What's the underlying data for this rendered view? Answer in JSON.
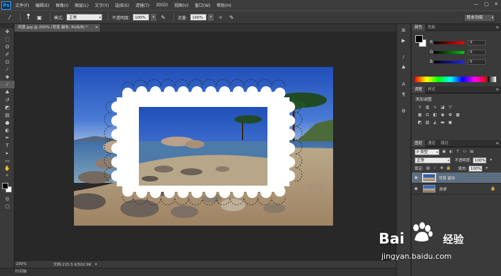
{
  "app": {
    "logo": "Ps"
  },
  "menu": {
    "items": [
      "文件(F)",
      "编辑(E)",
      "图像(I)",
      "图层(L)",
      "文字(Y)",
      "选择(S)",
      "滤镜(T)",
      "3D(D)",
      "视图(V)",
      "窗口(W)",
      "帮助(H)"
    ],
    "window_controls": [
      "—",
      "□",
      "✕"
    ]
  },
  "options_bar": {
    "brush_size": "8",
    "mode_label": "模式:",
    "mode_value": "正常",
    "opacity_label": "不透明度:",
    "opacity_value": "100%",
    "flow_label": "流量:",
    "flow_value": "100%",
    "workspace": "基本功能"
  },
  "document": {
    "tab_title": "风景.jpg @ 200% (背景 副本, RGB/8) *",
    "tab_close": "×"
  },
  "status": {
    "zoom": "200%",
    "doc_info": "文档:215.5 K/502.9K",
    "timeline": "时间轴"
  },
  "color_panel": {
    "tabs": [
      "颜色",
      "色板"
    ],
    "channels": [
      {
        "label": "R",
        "value": "0"
      },
      {
        "label": "G",
        "value": "0"
      },
      {
        "label": "B",
        "value": "0"
      }
    ]
  },
  "adjustments_panel": {
    "tabs": [
      "调整",
      "样式"
    ],
    "title": "添加调整"
  },
  "layers_panel": {
    "tabs": [
      "图层",
      "通道",
      "路径"
    ],
    "filter_label": "P 类型",
    "blend_mode": "正常",
    "opacity_label": "不透明度:",
    "opacity_value": "100%",
    "lock_label": "锁定:",
    "fill_label": "填充:",
    "fill_value": "100%",
    "layers": [
      {
        "name": "背景 副本",
        "selected": true
      },
      {
        "name": "背景",
        "selected": false
      }
    ]
  },
  "watermark": {
    "brand": "Bai",
    "brand2": "经验",
    "url": "jingyan.baidu.com"
  },
  "colors": {
    "selected_layer": "#5d6e80",
    "canvas_bg": "#282828",
    "panel_bg": "#3a3a3a"
  }
}
